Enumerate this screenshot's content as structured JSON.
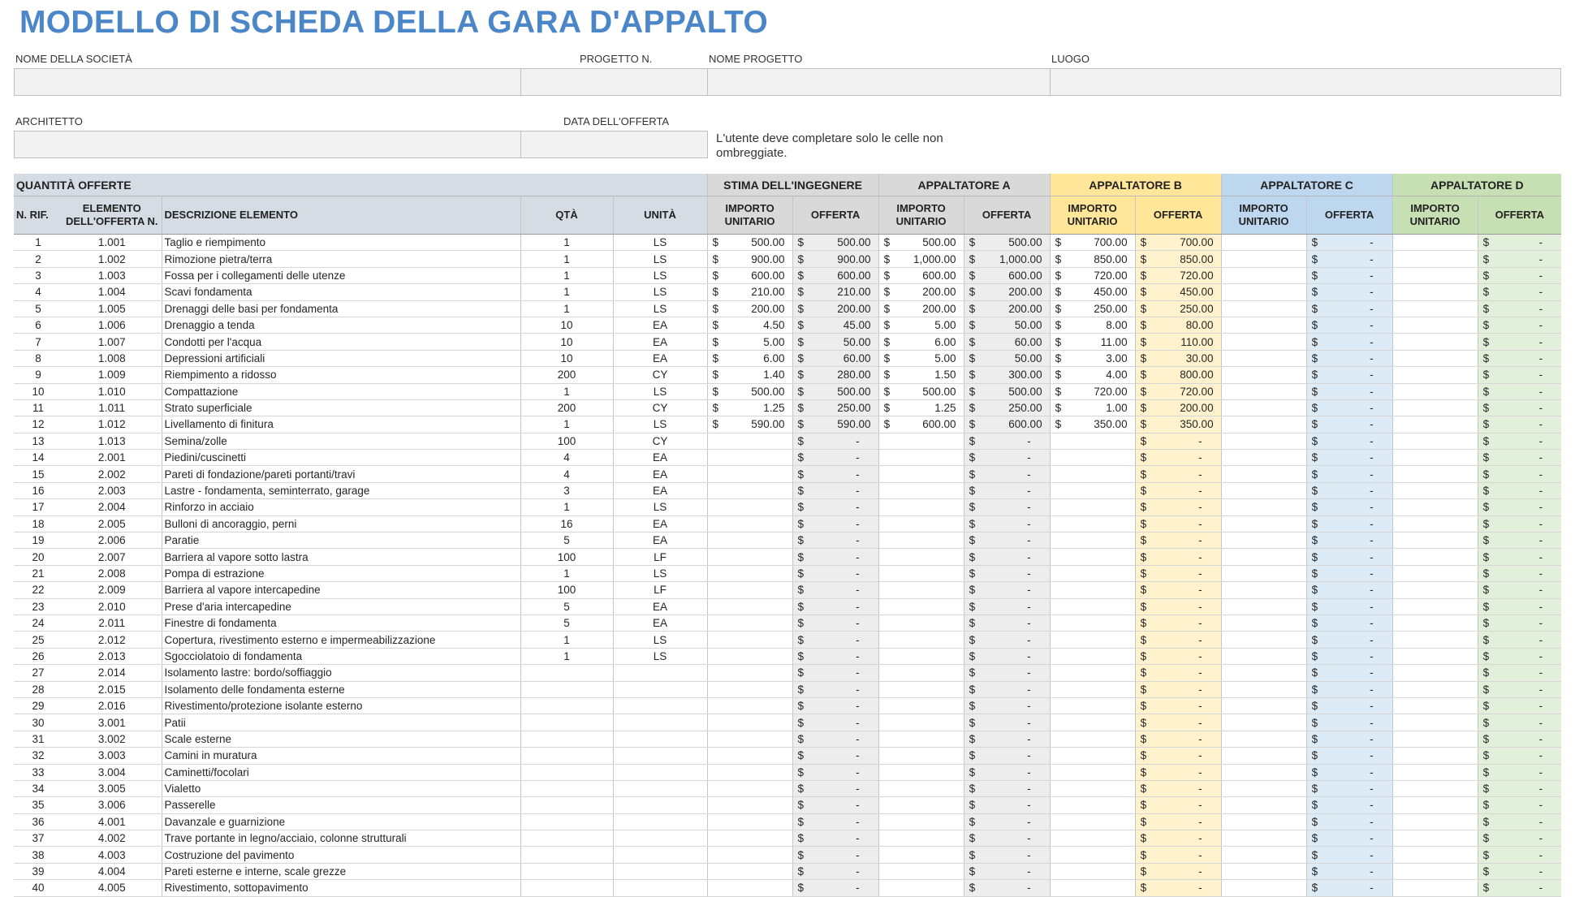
{
  "title": "MODELLO DI SCHEDA DELLA GARA D'APPALTO",
  "fields": {
    "company_label": "NOME DELLA SOCIETÀ",
    "project_no_label": "PROGETTO N.",
    "project_name_label": "NOME PROGETTO",
    "location_label": "LUOGO",
    "architect_label": "ARCHITETTO",
    "bid_date_label": "DATA DELL'OFFERTA",
    "note": "L'utente deve completare solo le celle non ombreggiate."
  },
  "table": {
    "section_quantities": "QUANTITÀ OFFERTE",
    "groups": [
      "STIMA DELL'INGEGNERE",
      "APPALTATORE A",
      "APPALTATORE B",
      "APPALTATORE C",
      "APPALTATORE D"
    ],
    "columns": {
      "ref": "N. RIF.",
      "item_no": "ELEMENTO DELL'OFFERTA N.",
      "desc": "DESCRIZIONE ELEMENTO",
      "qty": "QTÀ",
      "unit": "UNITÀ",
      "unit_price": "IMPORTO UNITARIO",
      "bid": "OFFERTA"
    },
    "currency": "$",
    "dash": "-",
    "rows": [
      {
        "ref": "1",
        "item": "1.001",
        "desc": "Taglio e riempimento",
        "qty": "1",
        "unit": "LS",
        "eng": [
          "500.00",
          "500.00"
        ],
        "a": [
          "500.00",
          "500.00"
        ],
        "b": [
          "700.00",
          "700.00"
        ]
      },
      {
        "ref": "2",
        "item": "1.002",
        "desc": "Rimozione pietra/terra",
        "qty": "1",
        "unit": "LS",
        "eng": [
          "900.00",
          "900.00"
        ],
        "a": [
          "1,000.00",
          "1,000.00"
        ],
        "b": [
          "850.00",
          "850.00"
        ]
      },
      {
        "ref": "3",
        "item": "1.003",
        "desc": "Fossa per i collegamenti delle utenze",
        "qty": "1",
        "unit": "LS",
        "eng": [
          "600.00",
          "600.00"
        ],
        "a": [
          "600.00",
          "600.00"
        ],
        "b": [
          "720.00",
          "720.00"
        ]
      },
      {
        "ref": "4",
        "item": "1.004",
        "desc": "Scavi fondamenta",
        "qty": "1",
        "unit": "LS",
        "eng": [
          "210.00",
          "210.00"
        ],
        "a": [
          "200.00",
          "200.00"
        ],
        "b": [
          "450.00",
          "450.00"
        ]
      },
      {
        "ref": "5",
        "item": "1.005",
        "desc": "Drenaggi delle basi per fondamenta",
        "qty": "1",
        "unit": "LS",
        "eng": [
          "200.00",
          "200.00"
        ],
        "a": [
          "200.00",
          "200.00"
        ],
        "b": [
          "250.00",
          "250.00"
        ]
      },
      {
        "ref": "6",
        "item": "1.006",
        "desc": "Drenaggio a tenda",
        "qty": "10",
        "unit": "EA",
        "eng": [
          "4.50",
          "45.00"
        ],
        "a": [
          "5.00",
          "50.00"
        ],
        "b": [
          "8.00",
          "80.00"
        ]
      },
      {
        "ref": "7",
        "item": "1.007",
        "desc": "Condotti per l'acqua",
        "qty": "10",
        "unit": "EA",
        "eng": [
          "5.00",
          "50.00"
        ],
        "a": [
          "6.00",
          "60.00"
        ],
        "b": [
          "11.00",
          "110.00"
        ]
      },
      {
        "ref": "8",
        "item": "1.008",
        "desc": "Depressioni artificiali",
        "qty": "10",
        "unit": "EA",
        "eng": [
          "6.00",
          "60.00"
        ],
        "a": [
          "5.00",
          "50.00"
        ],
        "b": [
          "3.00",
          "30.00"
        ]
      },
      {
        "ref": "9",
        "item": "1.009",
        "desc": "Riempimento a ridosso",
        "qty": "200",
        "unit": "CY",
        "eng": [
          "1.40",
          "280.00"
        ],
        "a": [
          "1.50",
          "300.00"
        ],
        "b": [
          "4.00",
          "800.00"
        ]
      },
      {
        "ref": "10",
        "item": "1.010",
        "desc": "Compattazione",
        "qty": "1",
        "unit": "LS",
        "eng": [
          "500.00",
          "500.00"
        ],
        "a": [
          "500.00",
          "500.00"
        ],
        "b": [
          "720.00",
          "720.00"
        ]
      },
      {
        "ref": "11",
        "item": "1.011",
        "desc": "Strato superficiale",
        "qty": "200",
        "unit": "CY",
        "eng": [
          "1.25",
          "250.00"
        ],
        "a": [
          "1.25",
          "250.00"
        ],
        "b": [
          "1.00",
          "200.00"
        ]
      },
      {
        "ref": "12",
        "item": "1.012",
        "desc": "Livellamento di finitura",
        "qty": "1",
        "unit": "LS",
        "eng": [
          "590.00",
          "590.00"
        ],
        "a": [
          "600.00",
          "600.00"
        ],
        "b": [
          "350.00",
          "350.00"
        ]
      },
      {
        "ref": "13",
        "item": "1.013",
        "desc": "Semina/zolle",
        "qty": "100",
        "unit": "CY"
      },
      {
        "ref": "14",
        "item": "2.001",
        "desc": "Piedini/cuscinetti",
        "qty": "4",
        "unit": "EA"
      },
      {
        "ref": "15",
        "item": "2.002",
        "desc": "Pareti di fondazione/pareti portanti/travi",
        "qty": "4",
        "unit": "EA"
      },
      {
        "ref": "16",
        "item": "2.003",
        "desc": "Lastre - fondamenta, seminterrato, garage",
        "qty": "3",
        "unit": "EA"
      },
      {
        "ref": "17",
        "item": "2.004",
        "desc": "Rinforzo in acciaio",
        "qty": "1",
        "unit": "LS"
      },
      {
        "ref": "18",
        "item": "2.005",
        "desc": "Bulloni di ancoraggio, perni",
        "qty": "16",
        "unit": "EA"
      },
      {
        "ref": "19",
        "item": "2.006",
        "desc": "Paratie",
        "qty": "5",
        "unit": "EA"
      },
      {
        "ref": "20",
        "item": "2.007",
        "desc": "Barriera al vapore sotto lastra",
        "qty": "100",
        "unit": "LF"
      },
      {
        "ref": "21",
        "item": "2.008",
        "desc": "Pompa di estrazione",
        "qty": "1",
        "unit": "LS"
      },
      {
        "ref": "22",
        "item": "2.009",
        "desc": "Barriera al vapore intercapedine",
        "qty": "100",
        "unit": "LF"
      },
      {
        "ref": "23",
        "item": "2.010",
        "desc": "Prese d'aria intercapedine",
        "qty": "5",
        "unit": "EA"
      },
      {
        "ref": "24",
        "item": "2.011",
        "desc": "Finestre di fondamenta",
        "qty": "5",
        "unit": "EA"
      },
      {
        "ref": "25",
        "item": "2.012",
        "desc": "Copertura, rivestimento esterno e impermeabilizzazione",
        "qty": "1",
        "unit": "LS"
      },
      {
        "ref": "26",
        "item": "2.013",
        "desc": "Sgocciolatoio di fondamenta",
        "qty": "1",
        "unit": "LS"
      },
      {
        "ref": "27",
        "item": "2.014",
        "desc": "Isolamento lastre: bordo/soffiaggio",
        "qty": "",
        "unit": ""
      },
      {
        "ref": "28",
        "item": "2.015",
        "desc": "Isolamento delle fondamenta esterne",
        "qty": "",
        "unit": ""
      },
      {
        "ref": "29",
        "item": "2.016",
        "desc": "Rivestimento/protezione isolante esterno",
        "qty": "",
        "unit": ""
      },
      {
        "ref": "30",
        "item": "3.001",
        "desc": "Patii",
        "qty": "",
        "unit": ""
      },
      {
        "ref": "31",
        "item": "3.002",
        "desc": "Scale esterne",
        "qty": "",
        "unit": ""
      },
      {
        "ref": "32",
        "item": "3.003",
        "desc": "Camini in muratura",
        "qty": "",
        "unit": ""
      },
      {
        "ref": "33",
        "item": "3.004",
        "desc": "Caminetti/focolari",
        "qty": "",
        "unit": ""
      },
      {
        "ref": "34",
        "item": "3.005",
        "desc": "Vialetto",
        "qty": "",
        "unit": ""
      },
      {
        "ref": "35",
        "item": "3.006",
        "desc": "Passerelle",
        "qty": "",
        "unit": ""
      },
      {
        "ref": "36",
        "item": "4.001",
        "desc": "Davanzale e guarnizione",
        "qty": "",
        "unit": ""
      },
      {
        "ref": "37",
        "item": "4.002",
        "desc": "Trave portante in legno/acciaio, colonne strutturali",
        "qty": "",
        "unit": ""
      },
      {
        "ref": "38",
        "item": "4.003",
        "desc": "Costruzione del pavimento",
        "qty": "",
        "unit": ""
      },
      {
        "ref": "39",
        "item": "4.004",
        "desc": "Pareti esterne e interne, scale grezze",
        "qty": "",
        "unit": ""
      },
      {
        "ref": "40",
        "item": "4.005",
        "desc": "Rivestimento, sottopavimento",
        "qty": "",
        "unit": ""
      }
    ]
  }
}
